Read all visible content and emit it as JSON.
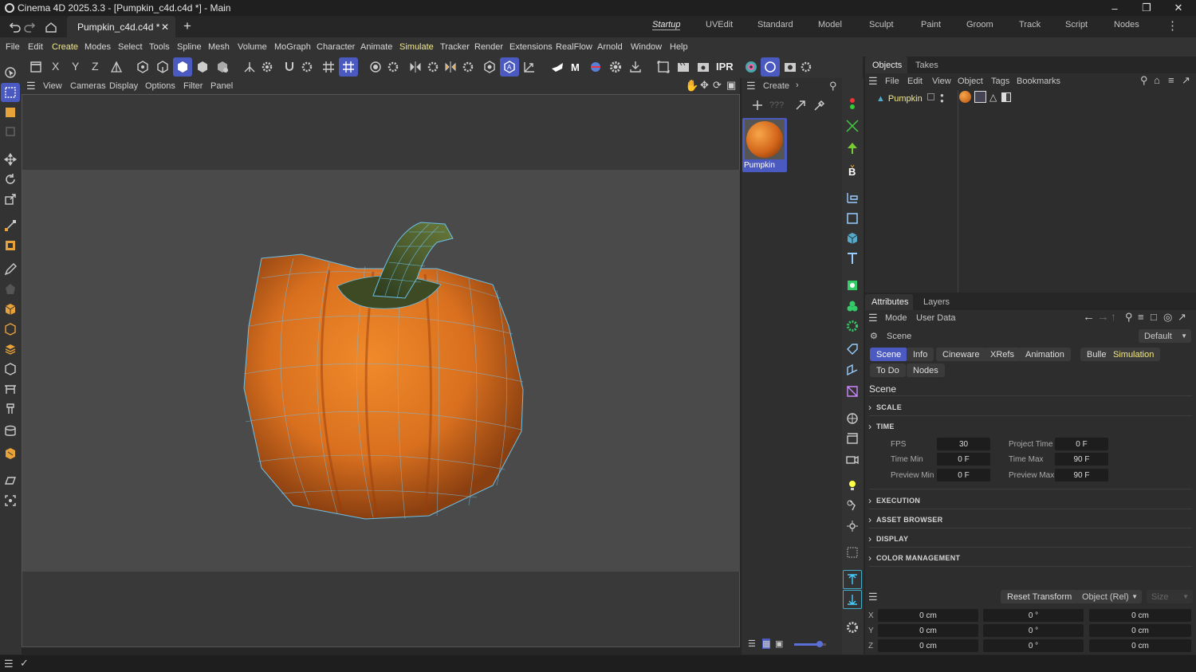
{
  "window": {
    "title": "Cinema 4D 2025.3.3 - [Pumpkin_c4d.c4d *] - Main",
    "min": "–",
    "max": "❐",
    "close": "✕"
  },
  "doc_tab": {
    "label": "Pumpkin_c4d.c4d *",
    "close": "✕",
    "add": "+"
  },
  "layouts": [
    "Startup",
    "UVEdit",
    "Standard",
    "Model",
    "Sculpt",
    "Paint",
    "Groom",
    "Track",
    "Script",
    "Nodes"
  ],
  "menu": [
    "File",
    "Edit",
    "Create",
    "Modes",
    "Select",
    "Tools",
    "Spline",
    "Mesh",
    "Volume",
    "MoGraph",
    "Character",
    "Animate",
    "Simulate",
    "Tracker",
    "Render",
    "Extensions",
    "RealFlow",
    "Arnold",
    "Window",
    "Help"
  ],
  "toolbar": {
    "axis_x": "X",
    "axis_y": "Y",
    "axis_z": "Z",
    "ipr": "IPR"
  },
  "viewport_menu": [
    "View",
    "Cameras",
    "Display",
    "Options",
    "Filter",
    "Panel"
  ],
  "materials": {
    "menu": "Create",
    "item": "Pumpkin"
  },
  "objects": {
    "tabs": [
      "Objects",
      "Takes"
    ],
    "menu": [
      "File",
      "Edit",
      "View",
      "Object",
      "Tags",
      "Bookmarks"
    ],
    "item": "Pumpkin"
  },
  "attributes": {
    "tabs": [
      "Attributes",
      "Layers"
    ],
    "menu": [
      "Mode",
      "User Data"
    ],
    "context": "Scene",
    "preset": "Default",
    "pills_row1": [
      "Scene",
      "Info",
      "Cineware",
      "XRefs",
      "Animation",
      "Bullet",
      "Simulation"
    ],
    "pills_row2": [
      "To Do",
      "Nodes"
    ],
    "heading": "Scene",
    "sections": [
      "SCALE",
      "TIME",
      "EXECUTION",
      "ASSET BROWSER",
      "DISPLAY",
      "COLOR MANAGEMENT"
    ],
    "time": {
      "fps_label": "FPS",
      "fps": "30",
      "project_time_label": "Project Time",
      "project_time": "0 F",
      "time_min_label": "Time Min",
      "time_min": "0 F",
      "time_max_label": "Time Max",
      "time_max": "90 F",
      "preview_min_label": "Preview Min",
      "preview_min": "0 F",
      "preview_max_label": "Preview Max",
      "preview_max": "90 F"
    }
  },
  "coords": {
    "reset": "Reset Transform",
    "mode": "Object (Rel)",
    "size": "Size",
    "x": "X",
    "y": "Y",
    "z": "Z",
    "pos": "0 cm",
    "rot": "0 °",
    "scl": "0 cm"
  },
  "colors": {
    "accent": "#4b5ac0",
    "highlight": "#f2e98a",
    "pumpkin": "#d9701f",
    "wire": "#5ab4e0"
  }
}
